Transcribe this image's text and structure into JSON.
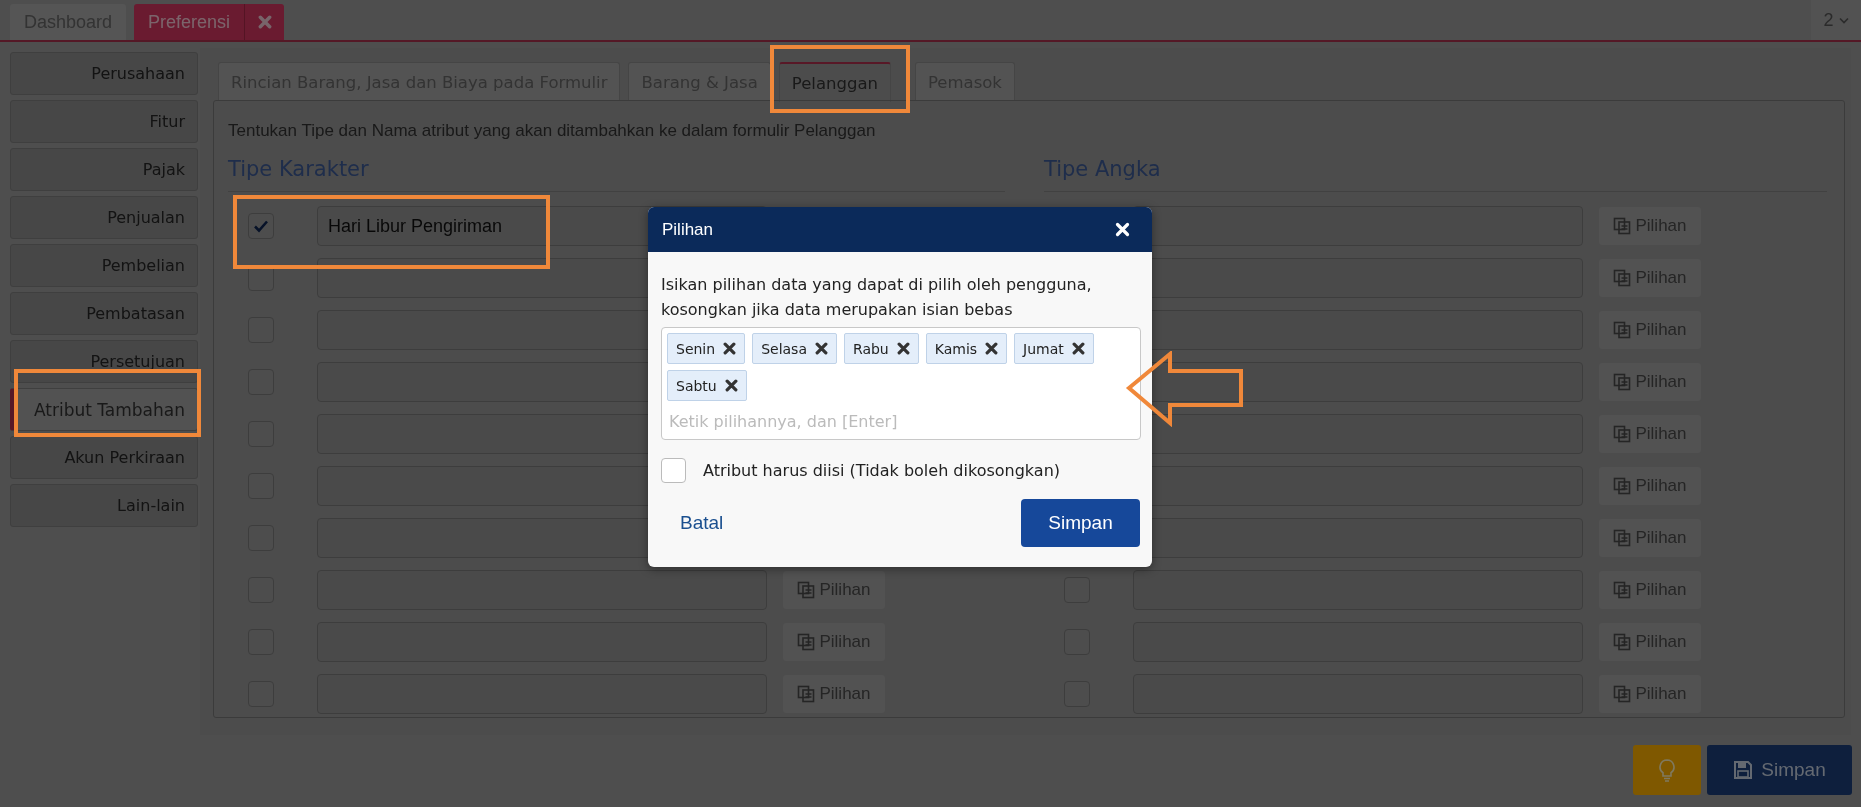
{
  "top_tabs": [
    {
      "label": "Dashboard",
      "selected": false,
      "closable": false
    },
    {
      "label": "Preferensi",
      "selected": true,
      "closable": true
    }
  ],
  "page_selector": {
    "label": "2"
  },
  "sidebar": {
    "items": [
      {
        "label": "Perusahaan",
        "selected": false
      },
      {
        "label": "Fitur",
        "selected": false
      },
      {
        "label": "Pajak",
        "selected": false
      },
      {
        "label": "Penjualan",
        "selected": false
      },
      {
        "label": "Pembelian",
        "selected": false
      },
      {
        "label": "Pembatasan",
        "selected": false
      },
      {
        "label": "Persetujuan",
        "selected": false
      },
      {
        "label": "Atribut Tambahan",
        "selected": true
      },
      {
        "label": "Akun Perkiraan",
        "selected": false
      },
      {
        "label": "Lain-lain",
        "selected": false
      }
    ]
  },
  "settings_tabs": [
    {
      "label": "Rincian Barang, Jasa dan Biaya pada Formulir",
      "selected": false
    },
    {
      "label": "Barang & Jasa",
      "selected": false
    },
    {
      "label": "Pelanggan",
      "selected": true
    },
    {
      "label": "Pemasok",
      "selected": false
    }
  ],
  "description": "Tentukan Tipe dan Nama atribut yang akan ditambahkan ke dalam formulir Pelanggan",
  "character_type": {
    "title": "Tipe Karakter",
    "rows": [
      {
        "checked": true,
        "value": "Hari Libur Pengiriman"
      },
      {
        "checked": false
      },
      {
        "checked": false
      },
      {
        "checked": false
      },
      {
        "checked": false
      },
      {
        "checked": false
      },
      {
        "checked": false
      },
      {
        "checked": false,
        "button": {
          "label": "Pilihan",
          "disabled": true
        }
      },
      {
        "checked": false,
        "button": {
          "label": "Pilihan",
          "disabled": true
        }
      },
      {
        "checked": false,
        "button": {
          "label": "Pilihan",
          "disabled": true
        }
      }
    ]
  },
  "number_type": {
    "title": "Tipe Angka",
    "rows": [
      {
        "button": {
          "label": "Pilihan",
          "disabled": true
        }
      },
      {
        "button": {
          "label": "Pilihan",
          "disabled": true
        }
      },
      {
        "button": {
          "label": "Pilihan",
          "disabled": true
        }
      },
      {
        "button": {
          "label": "Pilihan",
          "disabled": true
        }
      },
      {
        "button": {
          "label": "Pilihan",
          "disabled": true
        }
      },
      {
        "button": {
          "label": "Pilihan",
          "disabled": true
        }
      },
      {
        "button": {
          "label": "Pilihan",
          "disabled": true
        }
      },
      {
        "checked": false,
        "button": {
          "label": "Pilihan",
          "disabled": true
        }
      },
      {
        "checked": false,
        "button": {
          "label": "Pilihan",
          "disabled": true
        }
      },
      {
        "checked": false,
        "button": {
          "label": "Pilihan",
          "disabled": true
        }
      }
    ]
  },
  "footer_buttons": [
    {
      "kind": "hint"
    },
    {
      "kind": "save",
      "label": "Simpan"
    }
  ],
  "dialog": {
    "title": "Pilihan",
    "instruction": "Isikan pilihan data yang dapat di pilih oleh pengguna, kosongkan jika data merupakan isian bebas",
    "tags": [
      "Senin",
      "Selasa",
      "Rabu",
      "Kamis",
      "Jumat",
      "Sabtu"
    ],
    "placeholder": "Ketik pilihannya, dan [Enter]",
    "required": {
      "label": "Atribut harus diisi (Tidak boleh dikosongkan)",
      "checked": false
    },
    "cancel": "Batal",
    "confirm": "Simpan"
  }
}
